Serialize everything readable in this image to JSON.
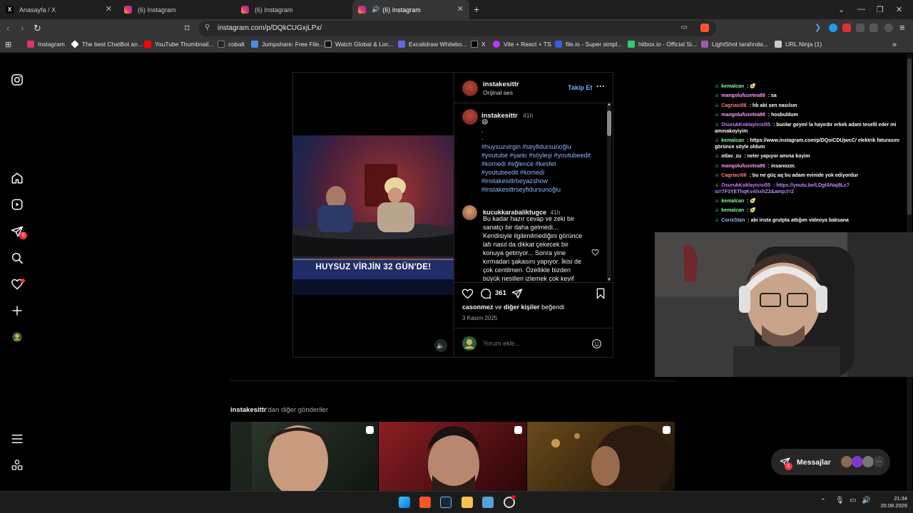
{
  "browser": {
    "tabs": [
      {
        "title": "Anasayfa / X",
        "icon": "x-logo-icon",
        "active": false
      },
      {
        "title": "(6) Instagram",
        "icon": "instagram-icon",
        "active": false
      },
      {
        "title": "(6) Instagram",
        "icon": "instagram-icon",
        "active": false
      },
      {
        "title": "(6) Instagram",
        "icon": "instagram-icon",
        "active": true,
        "audio": true
      }
    ],
    "url": "instagram.com/p/DQkCUGxjLPx/",
    "bookmarks": [
      {
        "label": "Instagram",
        "color": "#e1306c"
      },
      {
        "label": "The best ChatBot an...",
        "color": "#ffffff"
      },
      {
        "label": "YouTube Thumbnail...",
        "color": "#ff0000"
      },
      {
        "label": "cobalt",
        "color": "#111111"
      },
      {
        "label": "Jumpshare: Free File...",
        "color": "#4a90e2"
      },
      {
        "label": "Watch Global & Loc...",
        "color": "#111111"
      },
      {
        "label": "Excalidraw Whitebo...",
        "color": "#6965db"
      },
      {
        "label": "X",
        "color": "#000000"
      },
      {
        "label": "Vite + React + TS",
        "color": "#bd34fe"
      },
      {
        "label": "file.io - Super simpl...",
        "color": "#3b5bdb"
      },
      {
        "label": "hitbox.io - Official Si...",
        "color": "#2ecc71"
      },
      {
        "label": "LightShot tarafında...",
        "color": "#9b59b6"
      },
      {
        "label": "URL Ninja (1)",
        "color": "#cccccc"
      }
    ]
  },
  "instagram": {
    "sidebar_badges": {
      "reels": "6",
      "messages": "6"
    },
    "post": {
      "username": "instakesittr",
      "audio": "Orijinal ses",
      "follow": "Takip Et",
      "caption_user": "instakesittr",
      "caption_time": "41h",
      "caption_emoji": "😄",
      "caption_dots": [
        ".",
        "."
      ],
      "hashtags": [
        "#huysuzvirgin #seyfidursunoğlu",
        "#youtube #şarkı #söyleşi #youtubeedit",
        "#komedi #eğlence #kesfet",
        "#youtubeedit #komedi",
        "#instakesittrbeyazshow",
        "#instakesittrseyfidursunoğlu"
      ],
      "comment": {
        "user": "kucukkarabaliktugce",
        "time": "41h",
        "lines": [
          "Bu kadar hazır cevap ve zeki bir",
          "sanatçı bir daha gelmedi...",
          "Kendisiyle ilgilenilmediğini görünce",
          "lafı nasıl da dikkat çekecek bir",
          "konuya getiriyor... Sonra yine",
          "kırmadan şakasını yapıyor. İkisi de",
          "çok centilmen. Özellikle bizden",
          "büyük nesilleri izlemek çok keyif"
        ]
      },
      "comment_count": "361",
      "likes_user": "casonmez",
      "likes_mid": " ve ",
      "likes_others": "diğer kişiler",
      "likes_end": " beğendi",
      "date": "3 Kasım 2025",
      "comment_placeholder": "Yorum ekle...",
      "video_caption": "HUYSUZ VİRJİN 32 GÜN'DE!"
    },
    "more_from": {
      "user": "instakesittr",
      "suffix": "'dan diğer gönderiler"
    },
    "messages_label": "Messajlar",
    "messages_badge": "6"
  },
  "chat": [
    {
      "user": "kemalcan",
      "color": "#7fffa0",
      "msg": " : 🥑"
    },
    {
      "user": "mangolufusetea89",
      "color": "#ff9bf5",
      "msg": " : sa"
    },
    {
      "user": "Cagriaci06",
      "color": "#ff8080",
      "msg": " : hb abi sen nasılsın"
    },
    {
      "user": "mangolufusetea89",
      "color": "#ff9bf5",
      "msg": " : hosbuldum"
    },
    {
      "user": "OsurukKoklayicisi55",
      "color": "#d27bff",
      "msg": " : bunlar geyml la hayırdır erkek adam teselli eder mi amınakoyiyim"
    },
    {
      "user": "kemalcan",
      "color": "#7fffa0",
      "msg": " : https://www.instagram.com/p/DQoiCDUjwcC/ elektrik faturasını görünce söyle oldum"
    },
    {
      "user": "otlav_zu",
      "color": "#ffffff",
      "msg": " : neler yapıyor amına koyim"
    },
    {
      "user": "mangolufusetea89",
      "color": "#ff9bf5",
      "msg": " : insanozor."
    },
    {
      "user": "Cagriaci06",
      "color": "#ff8080",
      "msg": " : bu ne güç aq bu adam evinide yok ediyordur"
    },
    {
      "user": "OsurukKoklayicisi55",
      "color": "#d27bff",
      "msg": " : https://youtu.be/LDgfANaj9Lc?si=7F3YEThqKvAhxhZ2&amp;t=2"
    },
    {
      "user": "kemalcan",
      "color": "#7fffa0",
      "msg": " : 🥑"
    },
    {
      "user": "kemalcan",
      "color": "#7fffa0",
      "msg": " : 🥑"
    },
    {
      "user": "CorixStan",
      "color": "#9fb8ff",
      "msg": " : abi insta grutpta attığım videoya baksana"
    }
  ],
  "taskbar": {
    "time": "21:34",
    "date": "20.08.2026"
  }
}
